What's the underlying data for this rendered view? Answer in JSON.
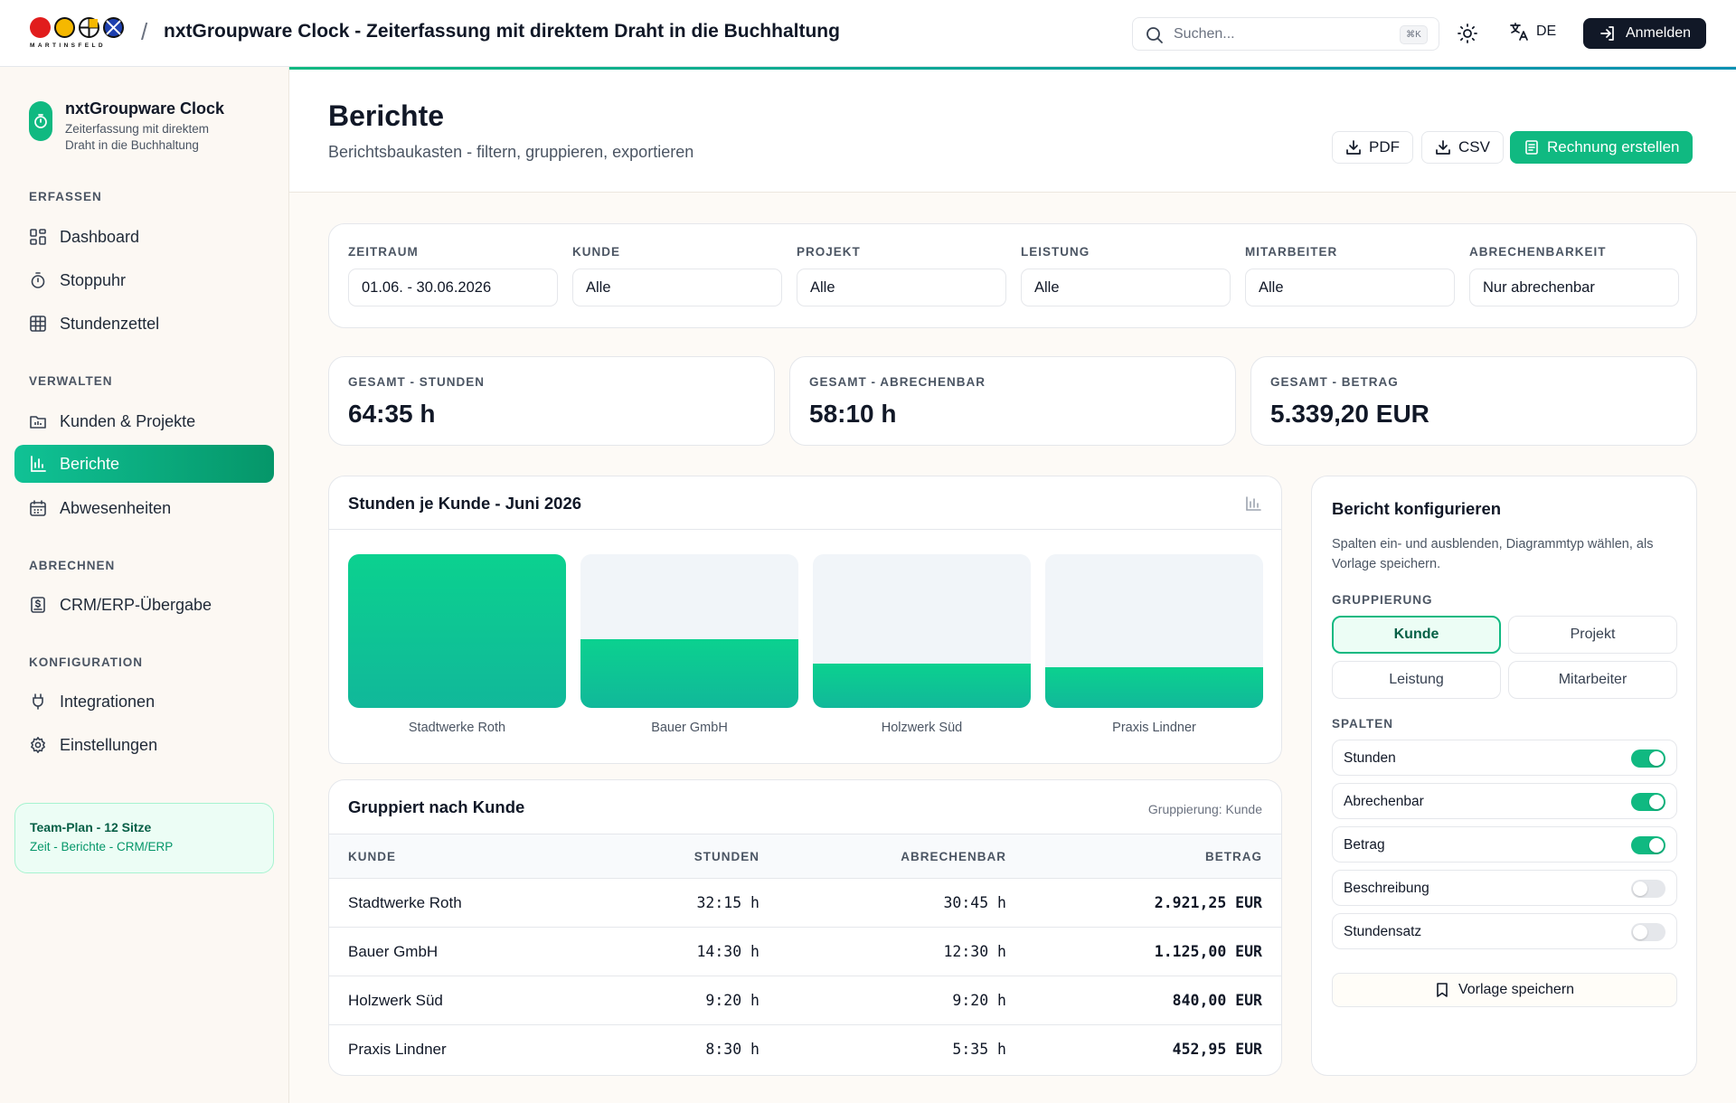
{
  "topbar": {
    "logo_text": "MARTINSFELD",
    "separator": "/",
    "title": "nxtGroupware Clock - Zeiterfassung mit direktem Draht in die Buchhaltung",
    "search_placeholder": "Suchen...",
    "search_shortcut": "⌘K",
    "language": "DE",
    "login_label": "Anmelden"
  },
  "sidebar": {
    "app_name": "nxtGroupware Clock",
    "app_subtitle": "Zeiterfassung mit direktem Draht in die Buchhaltung",
    "sections": [
      {
        "title": "ERFASSEN",
        "items": [
          {
            "label": "Dashboard",
            "icon": "dashboard-icon",
            "active": false
          },
          {
            "label": "Stoppuhr",
            "icon": "stopwatch-icon",
            "active": false
          },
          {
            "label": "Stundenzettel",
            "icon": "table-icon",
            "active": false
          }
        ]
      },
      {
        "title": "VERWALTEN",
        "items": [
          {
            "label": "Kunden & Projekte",
            "icon": "folder-icon",
            "active": false
          },
          {
            "label": "Berichte",
            "icon": "bar-chart-icon",
            "active": true
          },
          {
            "label": "Abwesenheiten",
            "icon": "calendar-icon",
            "active": false
          }
        ]
      },
      {
        "title": "ABRECHNEN",
        "items": [
          {
            "label": "CRM/ERP-Übergabe",
            "icon": "invoice-icon",
            "active": false
          }
        ]
      },
      {
        "title": "KONFIGURATION",
        "items": [
          {
            "label": "Integrationen",
            "icon": "plug-icon",
            "active": false
          },
          {
            "label": "Einstellungen",
            "icon": "gear-icon",
            "active": false
          }
        ]
      }
    ],
    "plan": {
      "title": "Team-Plan - 12 Sitze",
      "subtitle": "Zeit - Berichte - CRM/ERP"
    }
  },
  "page": {
    "title": "Berichte",
    "subtitle": "Berichtsbaukasten - filtern, gruppieren, exportieren",
    "buttons": {
      "pdf": "PDF",
      "csv": "CSV",
      "invoice": "Rechnung erstellen"
    }
  },
  "filters": [
    {
      "label": "ZEITRAUM",
      "value": "01.06. - 30.06.2026"
    },
    {
      "label": "KUNDE",
      "value": "Alle"
    },
    {
      "label": "PROJEKT",
      "value": "Alle"
    },
    {
      "label": "LEISTUNG",
      "value": "Alle"
    },
    {
      "label": "MITARBEITER",
      "value": "Alle"
    },
    {
      "label": "ABRECHENBARKEIT",
      "value": "Nur abrechenbar"
    }
  ],
  "kpis": [
    {
      "label": "GESAMT - STUNDEN",
      "value": "64:35 h"
    },
    {
      "label": "GESAMT - ABRECHENBAR",
      "value": "58:10 h"
    },
    {
      "label": "GESAMT - BETRAG",
      "value": "5.339,20 EUR"
    }
  ],
  "chart_data": {
    "type": "bar",
    "title": "Stunden je Kunde - Juni 2026",
    "categories": [
      "Stadtwerke Roth",
      "Bauer GmbH",
      "Holzwerk Süd",
      "Praxis Lindner"
    ],
    "values": [
      32.25,
      14.5,
      9.33,
      8.5
    ],
    "ylim": [
      0,
      32.25
    ],
    "colors": {
      "fill": "#10b981",
      "track": "#f1f5f9"
    }
  },
  "table": {
    "title": "Gruppiert nach Kunde",
    "subtitle": "Gruppierung: Kunde",
    "headers": [
      "KUNDE",
      "STUNDEN",
      "ABRECHENBAR",
      "BETRAG"
    ],
    "rows": [
      [
        "Stadtwerke Roth",
        "32:15 h",
        "30:45 h",
        "2.921,25 EUR"
      ],
      [
        "Bauer GmbH",
        "14:30 h",
        "12:30 h",
        "1.125,00 EUR"
      ],
      [
        "Holzwerk Süd",
        "9:20 h",
        "9:20 h",
        "840,00 EUR"
      ],
      [
        "Praxis Lindner",
        "8:30 h",
        "5:35 h",
        "452,95 EUR"
      ]
    ]
  },
  "config": {
    "title": "Bericht konfigurieren",
    "description": "Spalten ein- und ausblenden, Diagrammtyp wählen, als Vorlage speichern.",
    "grouping_label": "GRUPPIERUNG",
    "grouping": [
      {
        "label": "Kunde",
        "active": true
      },
      {
        "label": "Projekt",
        "active": false
      },
      {
        "label": "Leistung",
        "active": false
      },
      {
        "label": "Mitarbeiter",
        "active": false
      }
    ],
    "columns_label": "SPALTEN",
    "columns": [
      {
        "label": "Stunden",
        "on": true
      },
      {
        "label": "Abrechenbar",
        "on": true
      },
      {
        "label": "Betrag",
        "on": true
      },
      {
        "label": "Beschreibung",
        "on": false
      },
      {
        "label": "Stundensatz",
        "on": false
      }
    ],
    "save_label": "Vorlage speichern"
  }
}
